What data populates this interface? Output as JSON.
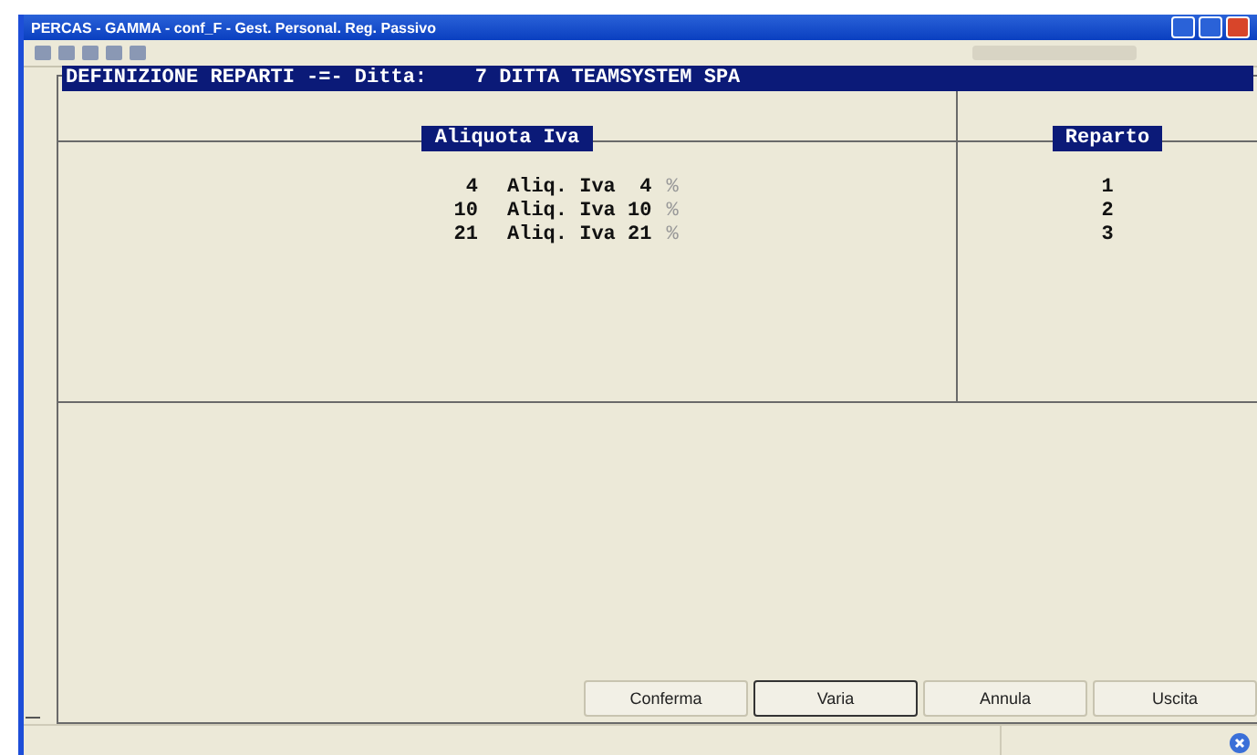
{
  "window": {
    "title": "PERCAS - GAMMA - conf_F - Gest. Personal. Reg. Passivo"
  },
  "form": {
    "title": "DEFINIZIONE REPARTI -=- Ditta:    7 DITTA TEAMSYSTEM SPA"
  },
  "table": {
    "columns": [
      "Aliquota Iva",
      "Reparto"
    ],
    "rows": [
      {
        "code": "4",
        "description": "Aliq. Iva  4",
        "percent": "%",
        "reparto": "1"
      },
      {
        "code": "10",
        "description": "Aliq. Iva 10",
        "percent": "%",
        "reparto": "2"
      },
      {
        "code": "21",
        "description": "Aliq. Iva 21",
        "percent": "%",
        "reparto": "3"
      }
    ]
  },
  "buttons": [
    {
      "label": "Conferma",
      "selected": false
    },
    {
      "label": "Varia",
      "selected": true
    },
    {
      "label": "Annula",
      "selected": false
    },
    {
      "label": "Uscita",
      "selected": false
    }
  ]
}
